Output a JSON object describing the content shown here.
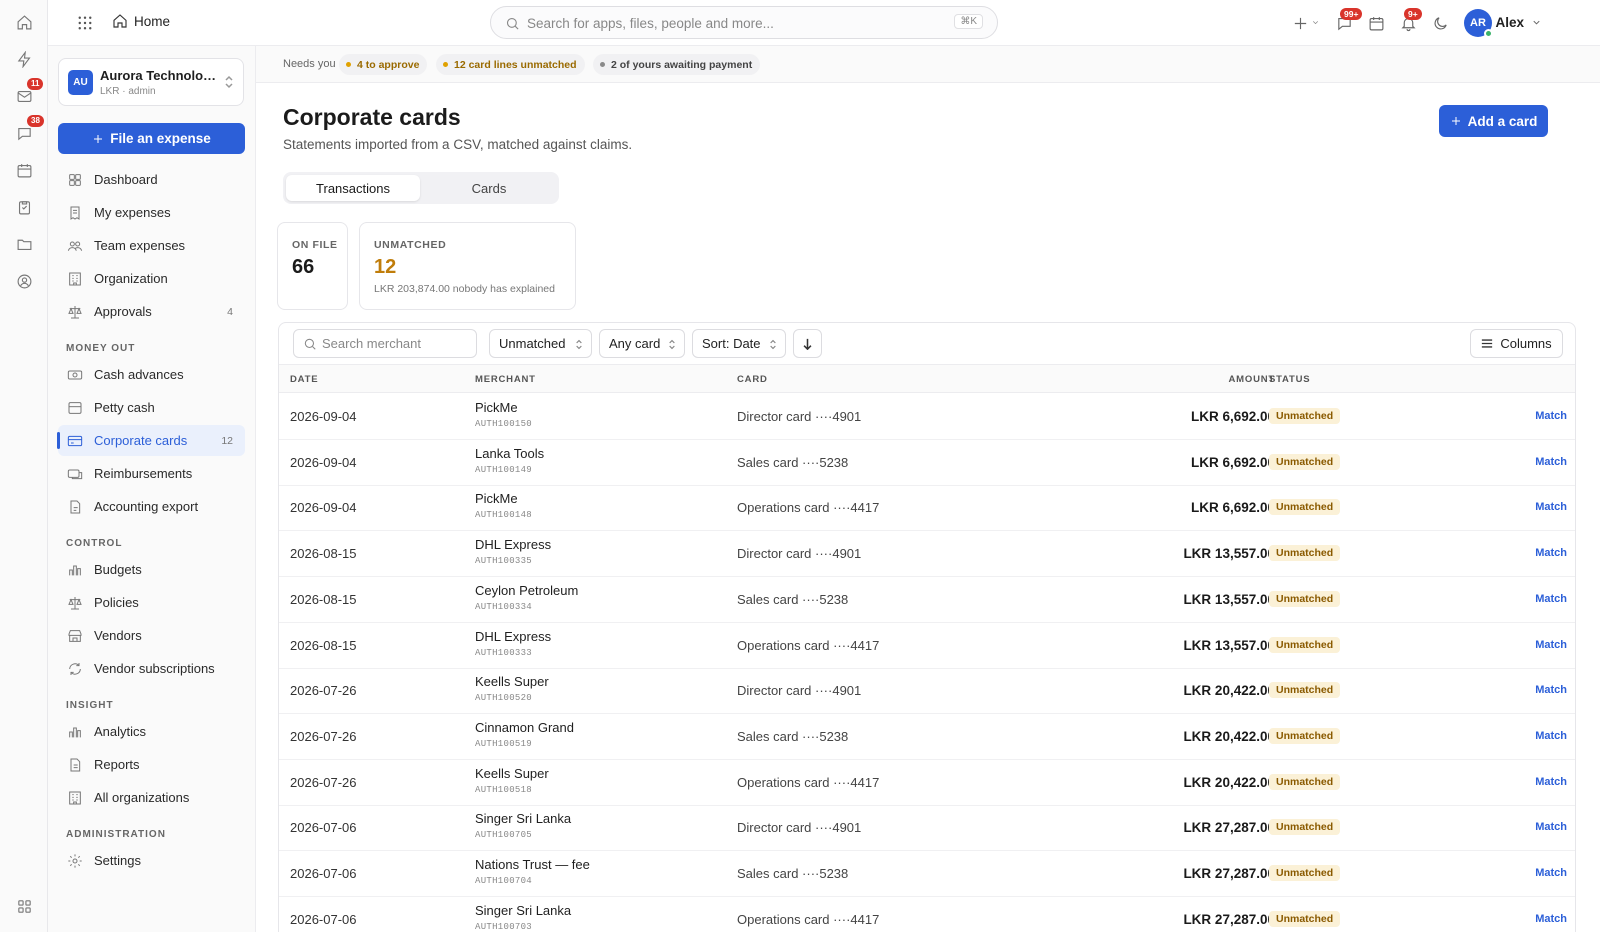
{
  "rail": {
    "items": [
      {
        "icon": "home-icon"
      },
      {
        "icon": "bolt-icon"
      },
      {
        "icon": "mail-icon",
        "badge": "11"
      },
      {
        "icon": "chat-icon",
        "badge": "38"
      },
      {
        "icon": "calendar-icon"
      },
      {
        "icon": "clipboard-icon"
      },
      {
        "icon": "folder-icon"
      },
      {
        "icon": "user-circle-icon"
      }
    ],
    "bottom_icon": "grid-icon"
  },
  "topbar": {
    "home_label": "Home",
    "search_placeholder": "Search for apps, files, people and more...",
    "search_shortcut": "⌘K",
    "mail_badge": "99+",
    "notif_badge": "9+",
    "user_initials": "AR",
    "user_name": "Alex"
  },
  "sidebar": {
    "org_logo": "AU",
    "org_name": "Aurora Technologies",
    "org_sub": "LKR · admin",
    "file_button": "File an expense",
    "main_items": [
      {
        "label": "Dashboard",
        "icon": "dashboard-icon"
      },
      {
        "label": "My expenses",
        "icon": "receipt-icon"
      },
      {
        "label": "Team expenses",
        "icon": "team-icon"
      },
      {
        "label": "Organization",
        "icon": "building-icon"
      },
      {
        "label": "Approvals",
        "icon": "scale-icon",
        "count": "4"
      }
    ],
    "sections": [
      {
        "title": "MONEY OUT",
        "items": [
          {
            "label": "Cash advances",
            "icon": "cash-icon"
          },
          {
            "label": "Petty cash",
            "icon": "box-icon"
          },
          {
            "label": "Corporate cards",
            "icon": "card-icon",
            "count": "12",
            "active": true
          },
          {
            "label": "Reimbursements",
            "icon": "reimburse-icon"
          },
          {
            "label": "Accounting export",
            "icon": "export-icon"
          }
        ]
      },
      {
        "title": "CONTROL",
        "items": [
          {
            "label": "Budgets",
            "icon": "bar-chart-icon"
          },
          {
            "label": "Policies",
            "icon": "scale-icon"
          },
          {
            "label": "Vendors",
            "icon": "store-icon"
          },
          {
            "label": "Vendor subscriptions",
            "icon": "refresh-icon"
          }
        ]
      },
      {
        "title": "INSIGHT",
        "items": [
          {
            "label": "Analytics",
            "icon": "bar-chart-icon"
          },
          {
            "label": "Reports",
            "icon": "document-icon"
          },
          {
            "label": "All organizations",
            "icon": "building-icon"
          }
        ]
      },
      {
        "title": "ADMINISTRATION",
        "items": [
          {
            "label": "Settings",
            "icon": "gear-icon"
          }
        ]
      }
    ]
  },
  "needs": {
    "label": "Needs you",
    "chips": [
      {
        "text": "4 to approve",
        "color": "#9a6a00",
        "dot": "#e0a100"
      },
      {
        "text": "12 card lines unmatched",
        "color": "#9a6a00",
        "dot": "#e0a100"
      },
      {
        "text": "2 of yours awaiting payment",
        "color": "#444444",
        "dot": "#8a8a8a"
      }
    ]
  },
  "page": {
    "title": "Corporate cards",
    "subtitle": "Statements imported from a CSV, matched against claims.",
    "add_button": "Add a card",
    "tabs": [
      "Transactions",
      "Cards"
    ]
  },
  "stats": {
    "on_file_label": "ON FILE",
    "on_file_value": "66",
    "unmatched_label": "UNMATCHED",
    "unmatched_value": "12",
    "unmatched_note": "LKR 203,874.00 nobody has explained"
  },
  "filters": {
    "search_placeholder": "Search merchant",
    "status": "Unmatched",
    "card": "Any card",
    "sort": "Sort: Date",
    "columns": "Columns"
  },
  "table": {
    "headers": {
      "date": "DATE",
      "merchant": "MERCHANT",
      "card": "CARD",
      "amount": "AMOUNT",
      "status": "STATUS"
    },
    "rows": [
      {
        "date": "2026-09-04",
        "merchant": "PickMe",
        "auth": "AUTH100150",
        "card": "Director card ····4901",
        "amount": "LKR 6,692.00",
        "status": "Unmatched",
        "action": "Match"
      },
      {
        "date": "2026-09-04",
        "merchant": "Lanka Tools",
        "auth": "AUTH100149",
        "card": "Sales card ····5238",
        "amount": "LKR 6,692.00",
        "status": "Unmatched",
        "action": "Match"
      },
      {
        "date": "2026-09-04",
        "merchant": "PickMe",
        "auth": "AUTH100148",
        "card": "Operations card ····4417",
        "amount": "LKR 6,692.00",
        "status": "Unmatched",
        "action": "Match"
      },
      {
        "date": "2026-08-15",
        "merchant": "DHL Express",
        "auth": "AUTH100335",
        "card": "Director card ····4901",
        "amount": "LKR 13,557.00",
        "status": "Unmatched",
        "action": "Match"
      },
      {
        "date": "2026-08-15",
        "merchant": "Ceylon Petroleum",
        "auth": "AUTH100334",
        "card": "Sales card ····5238",
        "amount": "LKR 13,557.00",
        "status": "Unmatched",
        "action": "Match"
      },
      {
        "date": "2026-08-15",
        "merchant": "DHL Express",
        "auth": "AUTH100333",
        "card": "Operations card ····4417",
        "amount": "LKR 13,557.00",
        "status": "Unmatched",
        "action": "Match"
      },
      {
        "date": "2026-07-26",
        "merchant": "Keells Super",
        "auth": "AUTH100520",
        "card": "Director card ····4901",
        "amount": "LKR 20,422.00",
        "status": "Unmatched",
        "action": "Match"
      },
      {
        "date": "2026-07-26",
        "merchant": "Cinnamon Grand",
        "auth": "AUTH100519",
        "card": "Sales card ····5238",
        "amount": "LKR 20,422.00",
        "status": "Unmatched",
        "action": "Match"
      },
      {
        "date": "2026-07-26",
        "merchant": "Keells Super",
        "auth": "AUTH100518",
        "card": "Operations card ····4417",
        "amount": "LKR 20,422.00",
        "status": "Unmatched",
        "action": "Match"
      },
      {
        "date": "2026-07-06",
        "merchant": "Singer Sri Lanka",
        "auth": "AUTH100705",
        "card": "Director card ····4901",
        "amount": "LKR 27,287.00",
        "status": "Unmatched",
        "action": "Match"
      },
      {
        "date": "2026-07-06",
        "merchant": "Nations Trust — fee",
        "auth": "AUTH100704",
        "card": "Sales card ····5238",
        "amount": "LKR 27,287.00",
        "status": "Unmatched",
        "action": "Match"
      },
      {
        "date": "2026-07-06",
        "merchant": "Singer Sri Lanka",
        "auth": "AUTH100703",
        "card": "Operations card ····4417",
        "amount": "LKR 27,287.00",
        "status": "Unmatched",
        "action": "Match"
      }
    ]
  }
}
